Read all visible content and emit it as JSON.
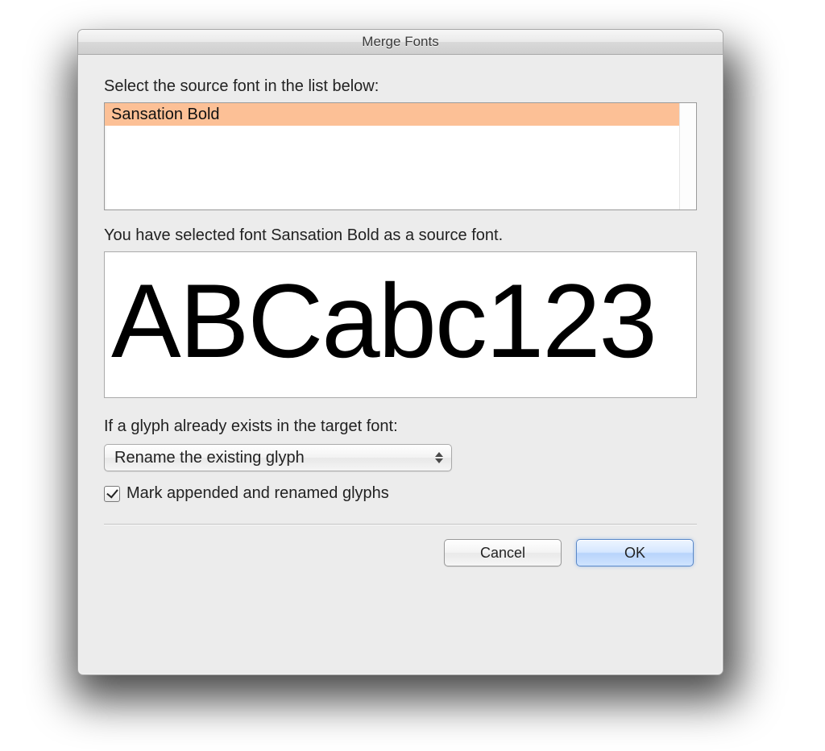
{
  "window": {
    "title": "Merge Fonts"
  },
  "source_list": {
    "label": "Select the source font in the list below:",
    "items": [
      "Sansation Bold"
    ],
    "selected_index": 0
  },
  "status_text": "You have selected font Sansation Bold as a source font.",
  "preview": {
    "sample_text": "ABCabc123"
  },
  "glyph_conflict": {
    "label": "If a glyph already exists in the target font:",
    "selected": "Rename the existing glyph"
  },
  "mark_checkbox": {
    "checked": true,
    "label": "Mark appended and renamed glyphs"
  },
  "buttons": {
    "cancel": "Cancel",
    "ok": "OK"
  }
}
